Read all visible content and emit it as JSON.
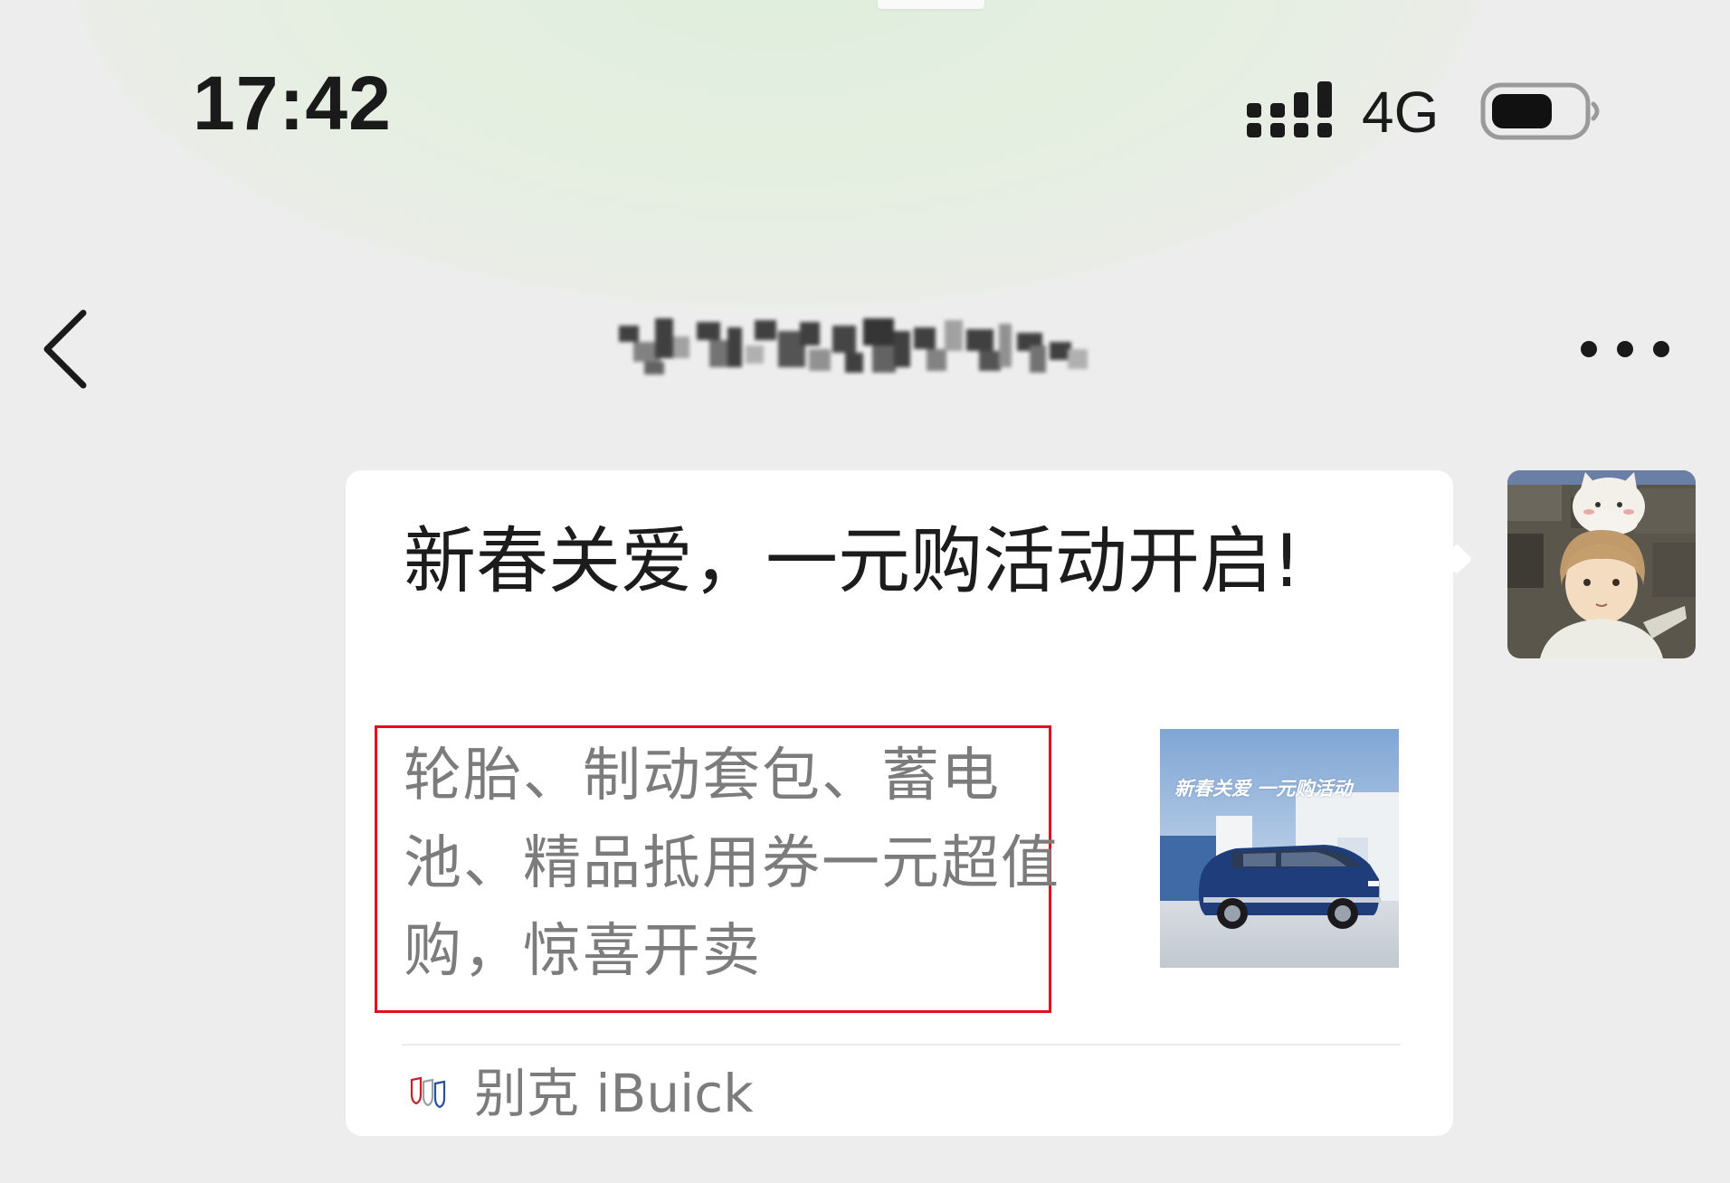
{
  "status_bar": {
    "time": "17:42",
    "network": "4G",
    "signal_icon": "cellular-signal-icon",
    "battery_icon": "battery-icon",
    "battery_level": 0.7
  },
  "nav": {
    "back_icon": "chevron-left-icon",
    "more_icon": "more-dots-icon"
  },
  "message": {
    "card": {
      "title": "新春关爱，一元购活动开启!",
      "description": "轮胎、制动套包、蓄电池、精品抵用券一元超值购，惊喜开卖",
      "thumbnail_caption": "新春关爱 一元购活动",
      "source": "别克 iBuick",
      "source_icon": "buick-logo-icon"
    }
  },
  "colors": {
    "highlight_border": "#e0111d",
    "bubble_bg": "#ffffff",
    "page_bg": "#ededed"
  }
}
